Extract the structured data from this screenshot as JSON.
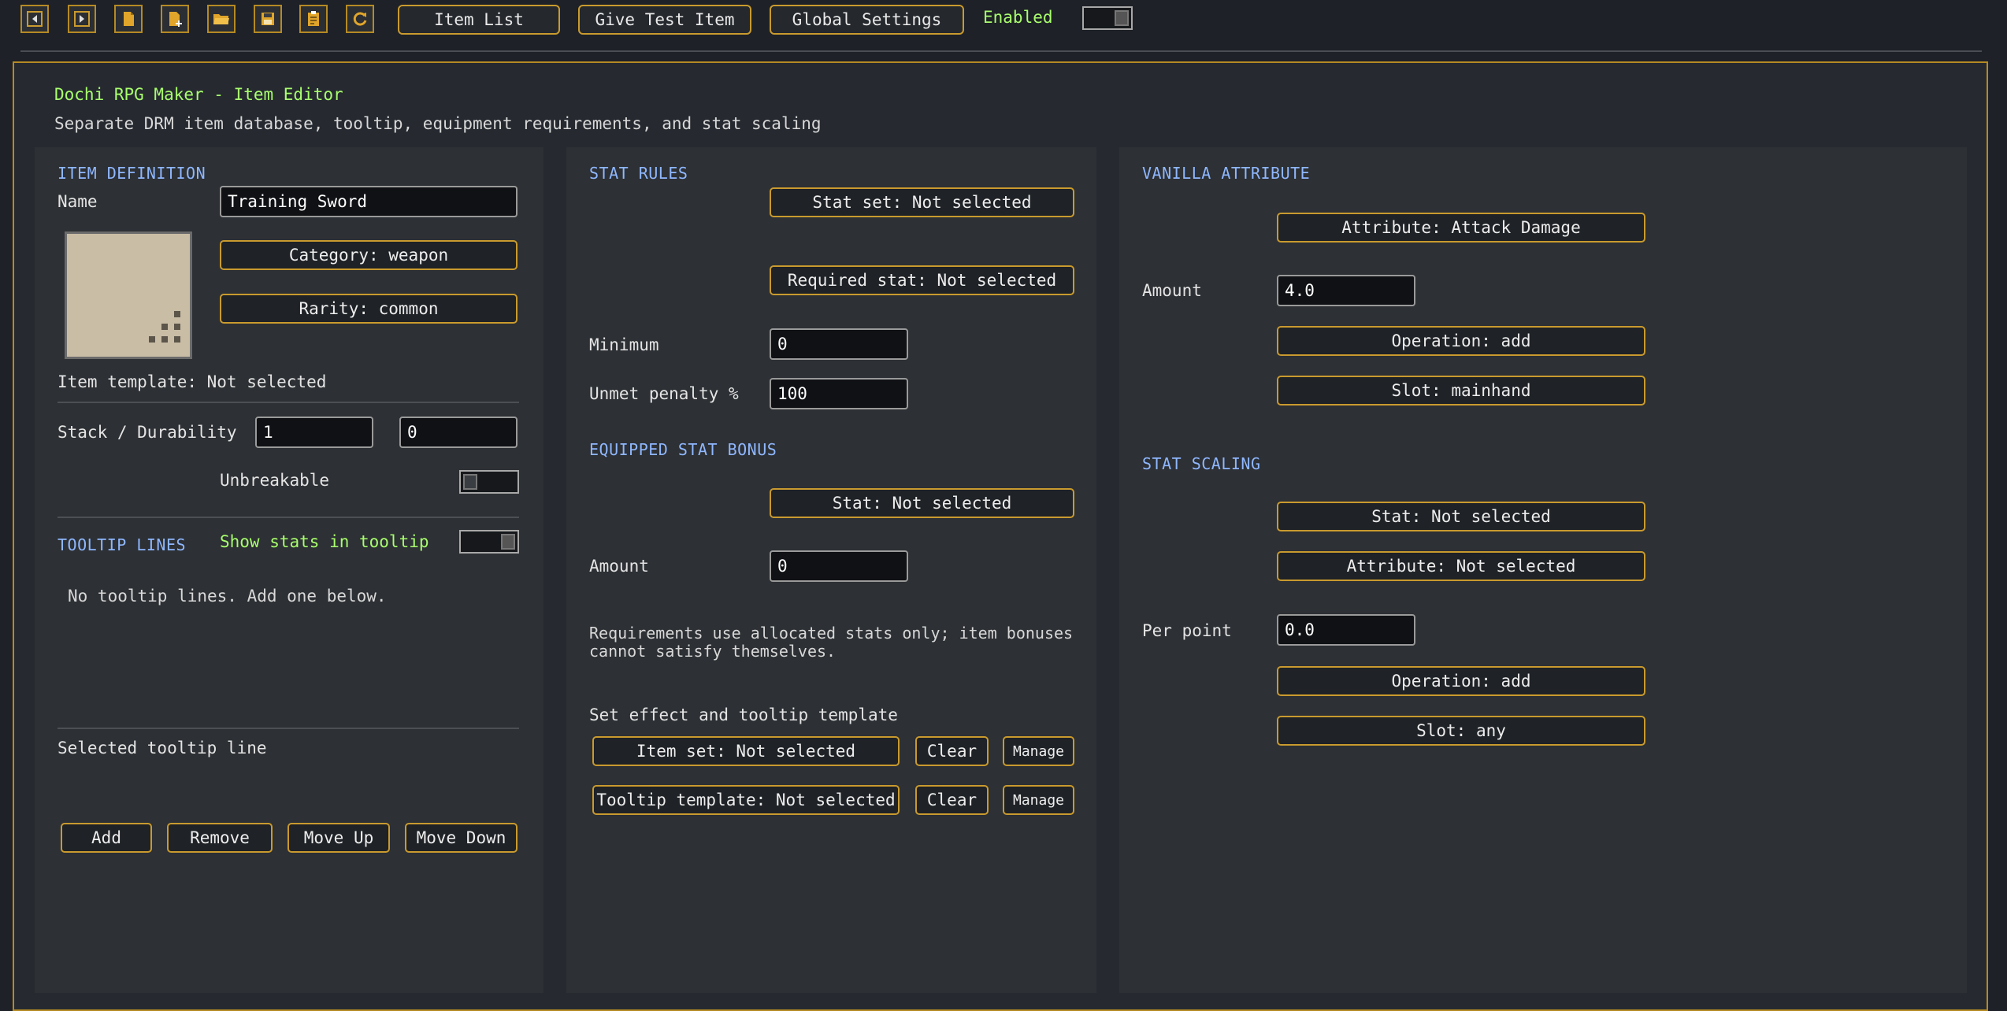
{
  "toolbar": {
    "icons": [
      "back-arrow-icon",
      "forward-arrow-icon",
      "new-file-icon",
      "add-file-icon",
      "open-folder-icon",
      "save-icon",
      "clipboard-icon",
      "refresh-icon"
    ],
    "item_list": "Item List",
    "give_test_item": "Give Test Item",
    "global_settings": "Global Settings",
    "enabled_label": "Enabled",
    "enabled": true
  },
  "header": {
    "title": "Dochi RPG Maker - Item Editor",
    "subtitle": "Separate DRM item database, tooltip, equipment requirements, and stat scaling"
  },
  "item_definition": {
    "section": "ITEM DEFINITION",
    "name_label": "Name",
    "name_value": "Training Sword",
    "category": "Category: weapon",
    "rarity": "Rarity: common",
    "template": "Item template: Not selected",
    "stack_durability_label": "Stack / Durability",
    "stack_value": "1",
    "durability_value": "0",
    "unbreakable_label": "Unbreakable",
    "unbreakable": false
  },
  "tooltip": {
    "section": "TOOLTIP LINES",
    "show_stats_label": "Show stats in tooltip",
    "show_stats": true,
    "empty_text": "No tooltip lines. Add one below.",
    "selected_label": "Selected tooltip line",
    "add": "Add",
    "remove": "Remove",
    "move_up": "Move Up",
    "move_down": "Move Down"
  },
  "stat_rules": {
    "section": "STAT RULES",
    "stat_set": "Stat set: Not selected",
    "required_stat": "Required stat: Not selected",
    "minimum_label": "Minimum",
    "minimum_value": "0",
    "penalty_label": "Unmet penalty %",
    "penalty_value": "100"
  },
  "equipped_bonus": {
    "section": "EQUIPPED STAT BONUS",
    "stat": "Stat: Not selected",
    "amount_label": "Amount",
    "amount_value": "0",
    "note": "Requirements use allocated stats only; item bonuses cannot satisfy themselves.",
    "set_effect_label": "Set effect and tooltip template",
    "item_set": "Item set: Not selected",
    "tooltip_template": "Tooltip template: Not selected",
    "clear": "Clear",
    "manage": "Manage"
  },
  "vanilla_attribute": {
    "section": "VANILLA ATTRIBUTE",
    "attribute": "Attribute: Attack Damage",
    "amount_label": "Amount",
    "amount_value": "4.0",
    "operation": "Operation: add",
    "slot": "Slot: mainhand"
  },
  "stat_scaling": {
    "section": "STAT SCALING",
    "stat": "Stat: Not selected",
    "attribute": "Attribute: Not selected",
    "per_point_label": "Per point",
    "per_point_value": "0.0",
    "operation": "Operation: add",
    "slot": "Slot: any"
  },
  "colors": {
    "accent_gold": "#c99a2e",
    "section_blue": "#8fb7ff",
    "enabled_green": "#a8ff6e"
  }
}
